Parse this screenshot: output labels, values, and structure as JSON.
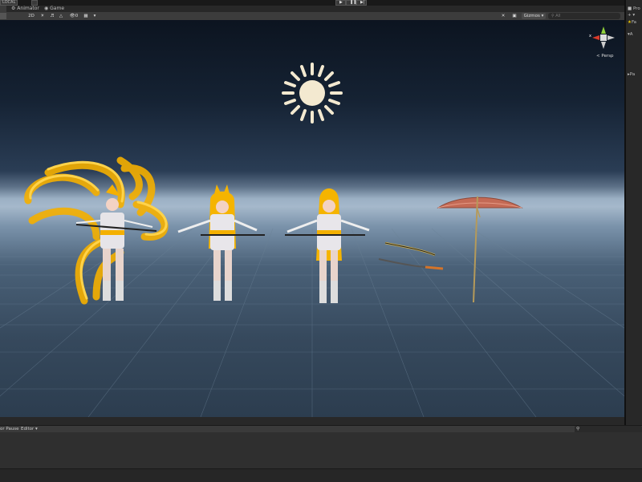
{
  "topbar": {
    "account_label": "LOCAL"
  },
  "tabs": [
    {
      "label": "Animator",
      "icon": "animator-icon"
    },
    {
      "label": "Game",
      "icon": "game-controller-icon"
    }
  ],
  "toolbar": {
    "mode_2d": "2D",
    "gizmos_label": "Gizmos",
    "search_placeholder": "All"
  },
  "scene": {
    "persp_label": "< Persp",
    "axis_x": "x",
    "objects": [
      "sun-light-icon",
      "fox-character-tails",
      "fox-character",
      "fox-character-long-hair",
      "katana-blade",
      "katana-sheath",
      "paper-umbrella"
    ]
  },
  "right_panel": {
    "items": [
      "Pro",
      "Fa",
      "A",
      "Pa"
    ]
  },
  "console": {
    "error_pause_label": "or Pause",
    "editor_label": "Editor ▾"
  },
  "colors": {
    "sky_top": "#0c1420",
    "horizon": "#a5b8cb",
    "ground": "#2c3d4f",
    "sun": "#f3e9d0",
    "hair": "#f5b400"
  }
}
